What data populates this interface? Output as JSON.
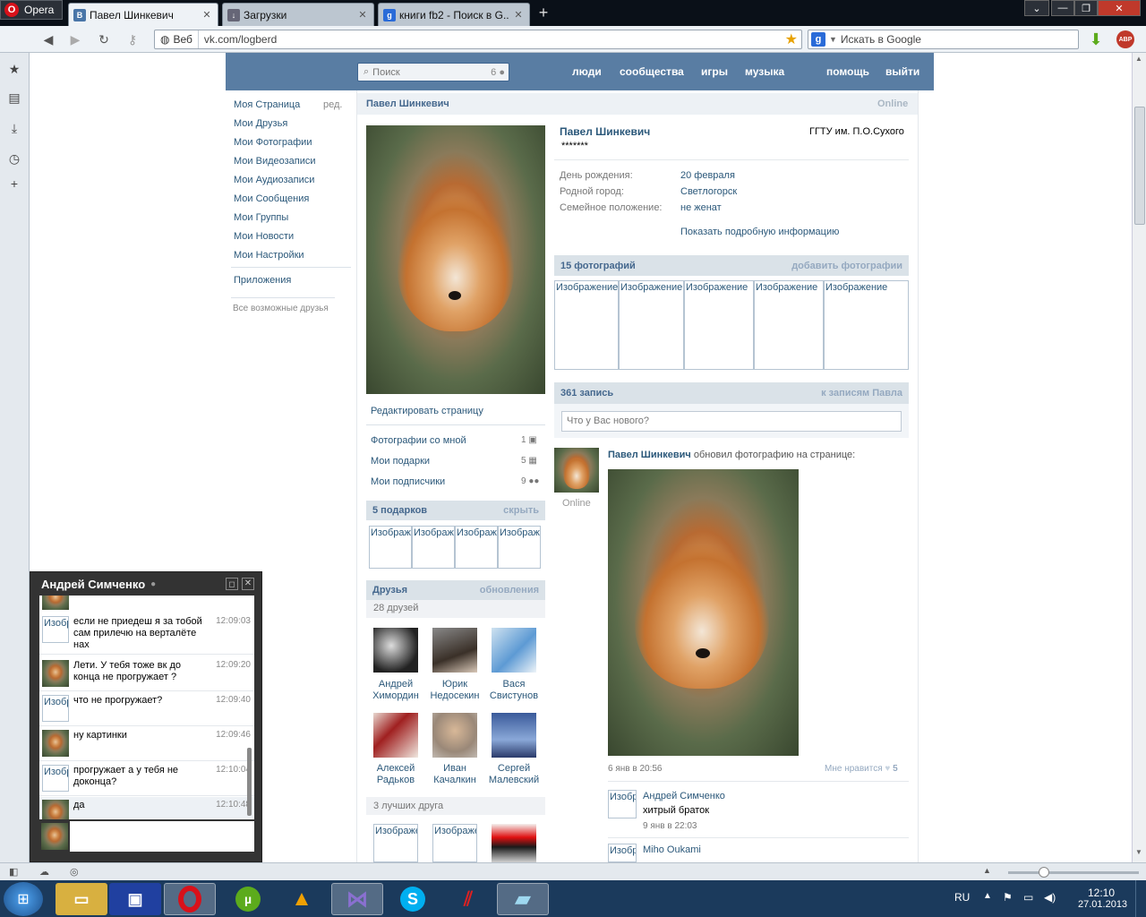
{
  "browser": {
    "menu_label": "Opera",
    "tabs": [
      {
        "title": "Павел Шинкевич",
        "favicon": "В"
      },
      {
        "title": "Загрузки",
        "favicon": "download-icon"
      },
      {
        "title": "книги fb2 - Поиск в G...",
        "favicon": "g"
      }
    ],
    "address_prefix": "Веб",
    "url": "vk.com/logberd",
    "search_placeholder": "Искать в Google",
    "adblock_label": "ABP"
  },
  "vk": {
    "header": {
      "search_placeholder": "Поиск",
      "search_count": "6",
      "nav": [
        "люди",
        "сообщества",
        "игры",
        "музыка",
        "помощь",
        "выйти"
      ]
    },
    "left_menu": {
      "items": [
        "Моя Страница",
        "Мои Друзья",
        "Мои Фотографии",
        "Мои Видеозаписи",
        "Мои Аудиозаписи",
        "Мои Сообщения",
        "Мои Группы",
        "Мои Новости",
        "Мои Настройки"
      ],
      "edit_label": "ред.",
      "apps_label": "Приложения",
      "friends_hint": "Все возможные друзья"
    },
    "profile": {
      "name_header": "Павел Шинкевич",
      "online": "Online",
      "name": "Павел Шинкевич",
      "status": "*******",
      "university": "ГГТУ им. П.О.Сухого",
      "info": [
        {
          "label": "День рождения:",
          "value": "20 февраля"
        },
        {
          "label": "Родной город:",
          "value": "Светлогорск"
        },
        {
          "label": "Семейное положение:",
          "value": "не женат"
        }
      ],
      "more_info": "Показать подробную информацию",
      "edit_page": "Редактировать страницу",
      "links": [
        {
          "label": "Фотографии со мной",
          "count": "1"
        },
        {
          "label": "Мои подарки",
          "count": "5"
        },
        {
          "label": "Мои подписчики",
          "count": "9"
        }
      ]
    },
    "gifts": {
      "title": "5 подарков",
      "action": "скрыть",
      "placeholder": "Изображение"
    },
    "friends": {
      "title": "Друзья",
      "action": "обновления",
      "count": "28 друзей",
      "list": [
        {
          "first": "Андрей",
          "last": "Химордин"
        },
        {
          "first": "Юрик",
          "last": "Недосекин"
        },
        {
          "first": "Вася",
          "last": "Свистунов"
        },
        {
          "first": "Алексей",
          "last": "Радьков"
        },
        {
          "first": "Иван",
          "last": "Качалкин"
        },
        {
          "first": "Сергей",
          "last": "Малевский"
        }
      ],
      "best_title": "3 лучших друга",
      "placeholder": "Изображе"
    },
    "photos": {
      "title": "15 фотографий",
      "action": "добавить фотографии",
      "placeholder": "Изображение"
    },
    "wall": {
      "title": "361 запись",
      "action": "к записям Павла",
      "input_placeholder": "Что у Вас нового?",
      "post": {
        "author": "Павел Шинкевич",
        "text": "обновил фотографию на странице:",
        "avatar_status": "Online",
        "date": "6 янв в 20:56",
        "like_label": "Мне нравится",
        "likes": "5"
      },
      "comments": [
        {
          "author": "Андрей Симченко",
          "text": "хитрый браток",
          "date": "9 янв в 22:03",
          "avatar": "Изобр"
        },
        {
          "author": "Miho Oukami",
          "text": "",
          "date": "",
          "avatar": "Изобр"
        }
      ]
    }
  },
  "chat": {
    "title": "Андрей Симченко",
    "messages": [
      {
        "avatar": "Изобр",
        "text": "если не приедеш я за тобой сам прилечю на верталёте нах",
        "time": "12:09:03"
      },
      {
        "avatar": "fox",
        "text": "Лети. У тебя тоже вк до конца не прогружает ?",
        "time": "12:09:20"
      },
      {
        "avatar": "Изобр",
        "text": "что не прогружает?",
        "time": "12:09:40"
      },
      {
        "avatar": "fox",
        "text": "ну картинки",
        "time": "12:09:46"
      },
      {
        "avatar": "Изобр",
        "text": "прогружает а у тебя не доконца?",
        "time": "12:10:04"
      },
      {
        "avatar": "fox",
        "text": "да",
        "time": "12:10:48"
      }
    ]
  },
  "taskbar": {
    "lang": "RU",
    "time": "12:10",
    "date": "27.01.2013"
  }
}
